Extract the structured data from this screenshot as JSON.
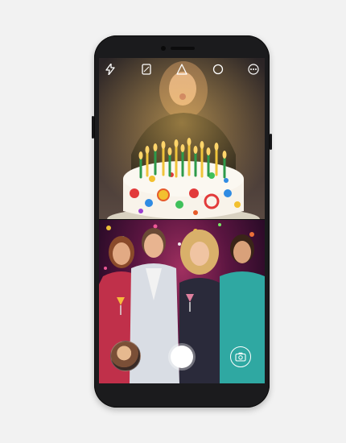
{
  "toolbar": {
    "icons": [
      "flash-icon",
      "aspect-ratio-icon",
      "triangle-filter-icon",
      "circle-mode-icon",
      "more-options-icon"
    ]
  },
  "scene_top": {
    "description_hidden": ""
  },
  "camera": {
    "shutter": "shutter-button",
    "switch": "switch-camera-icon",
    "gallery": "gallery-thumbnail"
  },
  "colors": {
    "phone_body": "#1b1b1d",
    "background": "#f2f2f2",
    "shutter": "#ffffff"
  }
}
